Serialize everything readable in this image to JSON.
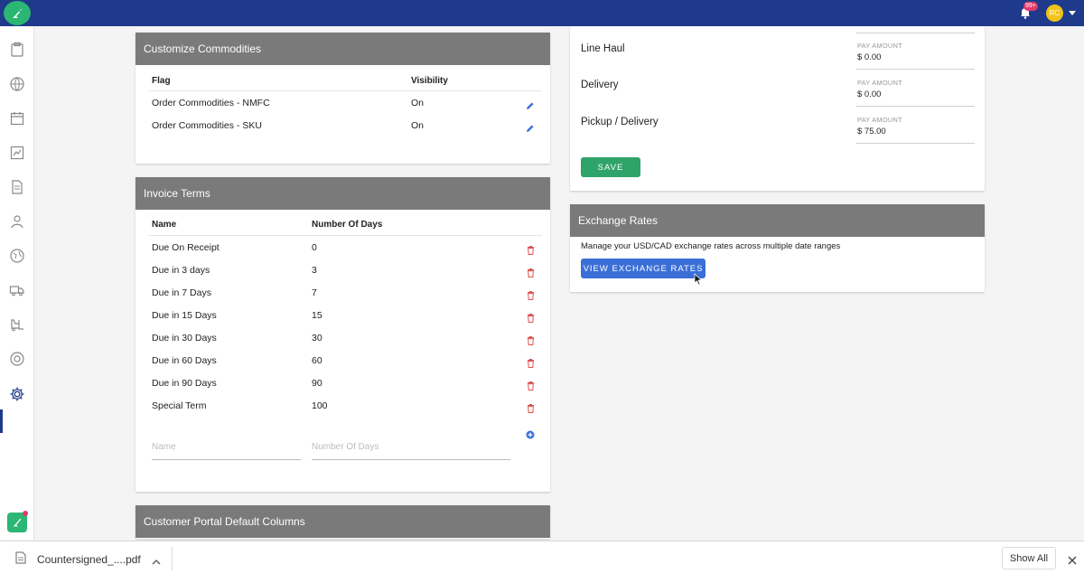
{
  "topbar": {
    "notification_badge": "99+",
    "user_initials": "RC"
  },
  "commodities": {
    "title": "Customize Commodities",
    "col_flag": "Flag",
    "col_visibility": "Visibility",
    "rows": [
      {
        "flag": "Order Commodities - NMFC",
        "visibility": "On"
      },
      {
        "flag": "Order Commodities - SKU",
        "visibility": "On"
      }
    ]
  },
  "invoice_terms": {
    "title": "Invoice Terms",
    "col_name": "Name",
    "col_days": "Number Of Days",
    "rows": [
      {
        "name": "Due On Receipt",
        "days": "0"
      },
      {
        "name": "Due in 3 days",
        "days": "3"
      },
      {
        "name": "Due in 7 Days",
        "days": "7"
      },
      {
        "name": "Due in 15 Days",
        "days": "15"
      },
      {
        "name": "Due in 30 Days",
        "days": "30"
      },
      {
        "name": "Due in 60 Days",
        "days": "60"
      },
      {
        "name": "Due in 90 Days",
        "days": "90"
      },
      {
        "name": "Special Term",
        "days": "100"
      }
    ],
    "name_placeholder": "Name",
    "days_placeholder": "Number Of Days"
  },
  "portal_columns": {
    "title": "Customer Portal Default Columns"
  },
  "charges": {
    "pay_label": "PAY AMOUNT",
    "rows": [
      {
        "name": "Line Haul",
        "amount": "$ 0.00"
      },
      {
        "name": "Delivery",
        "amount": "$ 0.00"
      },
      {
        "name": "Pickup / Delivery",
        "amount": "$ 75.00"
      }
    ],
    "save_label": "SAVE"
  },
  "exchange_rates": {
    "title": "Exchange Rates",
    "description": "Manage your USD/CAD exchange rates across multiple date ranges",
    "button_label": "VIEW EXCHANGE RATES"
  },
  "download_bar": {
    "filename": "Countersigned_....pdf",
    "show_all": "Show All"
  }
}
